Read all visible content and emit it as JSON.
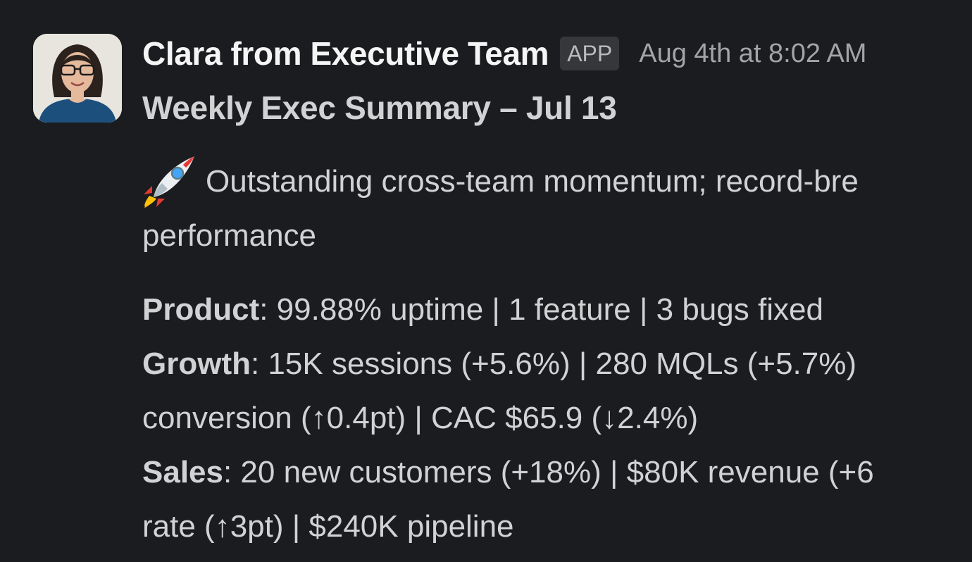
{
  "message": {
    "sender": "Clara from Executive Team",
    "badge": "APP",
    "timestamp": "Aug 4th at 8:02 AM",
    "title": "Weekly Exec Summary – Jul 13",
    "intro": {
      "emoji": "rocket",
      "line1": "Outstanding cross-team momentum; record-bre",
      "line2": "performance"
    },
    "stats": {
      "product": {
        "label": "Product",
        "line1": ": 99.88% uptime | 1 feature | 3 bugs fixed"
      },
      "growth": {
        "label": "Growth",
        "line1": ": 15K sessions (+5.6%) | 280 MQLs (+5.7%)",
        "line2": "conversion (↑0.4pt) | CAC $65.9 (↓2.4%)"
      },
      "sales": {
        "label": "Sales",
        "line1": ": 20 new customers (+18%) | $80K revenue (+6",
        "line2": "rate (↑3pt) | $240K pipeline"
      }
    }
  },
  "colors": {
    "background": "#1b1c1f",
    "sender": "#f5f5f6",
    "text": "#d1d2d3",
    "muted": "#a3a4a7",
    "badge_bg": "#36373b"
  }
}
